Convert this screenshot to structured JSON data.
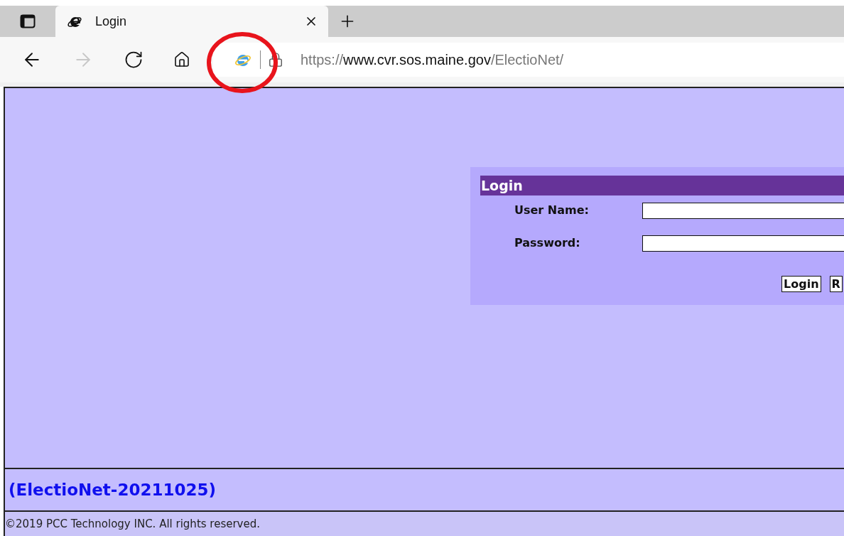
{
  "browser": {
    "tab": {
      "title": "Login",
      "selected": true
    },
    "address": {
      "scheme": "https://",
      "host": "www.cvr.sos.maine.gov",
      "path": "/ElectioNet/"
    },
    "forward_disabled": true,
    "annotation": {
      "kind": "circle",
      "color": "#e8141c"
    }
  },
  "login_panel": {
    "title": "Login",
    "fields": [
      {
        "label": "User Name:"
      },
      {
        "label": "Password:"
      }
    ],
    "buttons": [
      "Login",
      "R"
    ]
  },
  "version": "(ElectioNet-20211025)",
  "copyright": "©2019 PCC Technology INC. All rights reserved."
}
